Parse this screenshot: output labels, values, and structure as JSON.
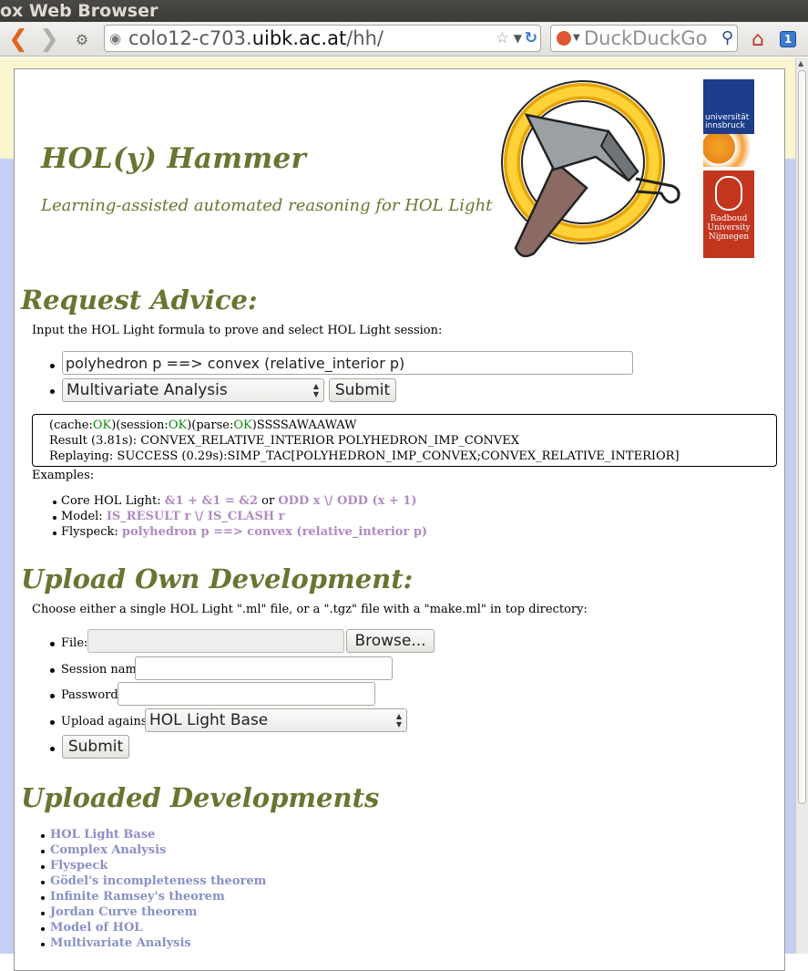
{
  "window": {
    "title": "ox Web Browser"
  },
  "toolbar": {
    "url_prefix": "colo12-c703.",
    "url_domain": "uibk.ac.at",
    "url_path": "/hh/",
    "search_placeholder": "DuckDuckGo",
    "tab_count": "1"
  },
  "header": {
    "title": "HOL(y) Hammer",
    "subtitle": "Learning-assisted automated reasoning for HOL Light",
    "innsbruck_logo_text": "universität innsbruck",
    "radboud_logo_text": [
      "Radboud",
      "University",
      "Nijmegen"
    ]
  },
  "request": {
    "heading": "Request Advice:",
    "instruction": "Input the HOL Light formula to prove and select HOL Light session:",
    "formula_value": "polyhedron p ==> convex (relative_interior p)",
    "session_selected": "Multivariate Analysis",
    "submit_label": "Submit",
    "result": {
      "l1_a": "(cache:",
      "l1_b": "OK",
      "l1_c": ")(session:",
      "l1_d": "OK",
      "l1_e": ")(parse:",
      "l1_f": "OK",
      "l1_g": ")SSSSAWAAWAW",
      "l2": "Result (3.81s): CONVEX_RELATIVE_INTERIOR POLYHEDRON_IMP_CONVEX",
      "l3": "Replaying: SUCCESS (0.29s):SIMP_TAC[POLYHEDRON_IMP_CONVEX;CONVEX_RELATIVE_INTERIOR]"
    },
    "examples_label": "Examples:",
    "examples": {
      "core_label": "Core HOL Light: ",
      "core_ex1": "&1 + &1 = &2",
      "core_or": " or ",
      "core_ex2": "ODD x \\/ ODD (x + 1)",
      "model_label": "Model: ",
      "model_ex": "IS_RESULT r \\/ IS_CLASH r",
      "flyspeck_label": "Flyspeck: ",
      "flyspeck_ex": "polyhedron p ==> convex (relative_interior p)"
    }
  },
  "upload": {
    "heading": "Upload Own Development:",
    "instruction": "Choose either a single HOL Light \".ml\" file, or a \".tgz\" file with a \"make.ml\" in top directory:",
    "file_label": "File:",
    "browse_label": "Browse...",
    "session_label": "Session name:",
    "password_label": "Password:",
    "against_label": "Upload against:",
    "against_selected": "HOL Light Base",
    "submit_label": "Submit"
  },
  "uploaded": {
    "heading": "Uploaded Developments",
    "items": [
      "HOL Light Base",
      "Complex Analysis",
      "Flyspeck",
      "Gödel's incompleteness theorem",
      "Infinite Ramsey's theorem",
      "Jordan Curve theorem",
      "Model of HOL",
      "Multivariate Analysis"
    ]
  },
  "colors": {
    "heading_olive": "#6b7431",
    "ok_green": "#118811",
    "example_link": "#b18ac0",
    "dev_link": "#8a8fc6"
  }
}
